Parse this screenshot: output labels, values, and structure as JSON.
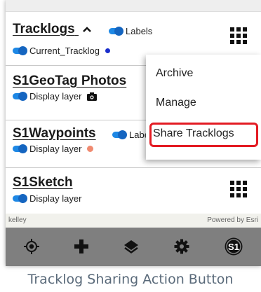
{
  "layers": {
    "tracklogs": {
      "title": "Tracklogs",
      "labels_toggle": "Labels",
      "sublayer": "Current_Tracklog"
    },
    "geotag": {
      "title": "S1GeoTag Photos",
      "display": "Display layer"
    },
    "waypoints": {
      "title": "S1Waypoints",
      "labels_toggle": "Labe",
      "display": "Display layer"
    },
    "sketch": {
      "title": "S1Sketch",
      "display": "Display layer"
    }
  },
  "menu": {
    "items": [
      "Archive",
      "Manage",
      "Share Tracklogs"
    ]
  },
  "map": {
    "left_text": "kelley",
    "attribution": "Powered by Esri"
  },
  "toolbar": {
    "icons": [
      "locate-icon",
      "add-icon",
      "layers-icon",
      "settings-icon",
      "s1-logo-icon"
    ]
  },
  "caption": "Tracklog Sharing Action Button",
  "colors": {
    "toggle": "#1e88e5",
    "highlight": "#e31b23",
    "waypoint_dot": "#f08a70",
    "tracklog_dot": "#1a2ecc",
    "toolbar": "#7f7f7f"
  }
}
